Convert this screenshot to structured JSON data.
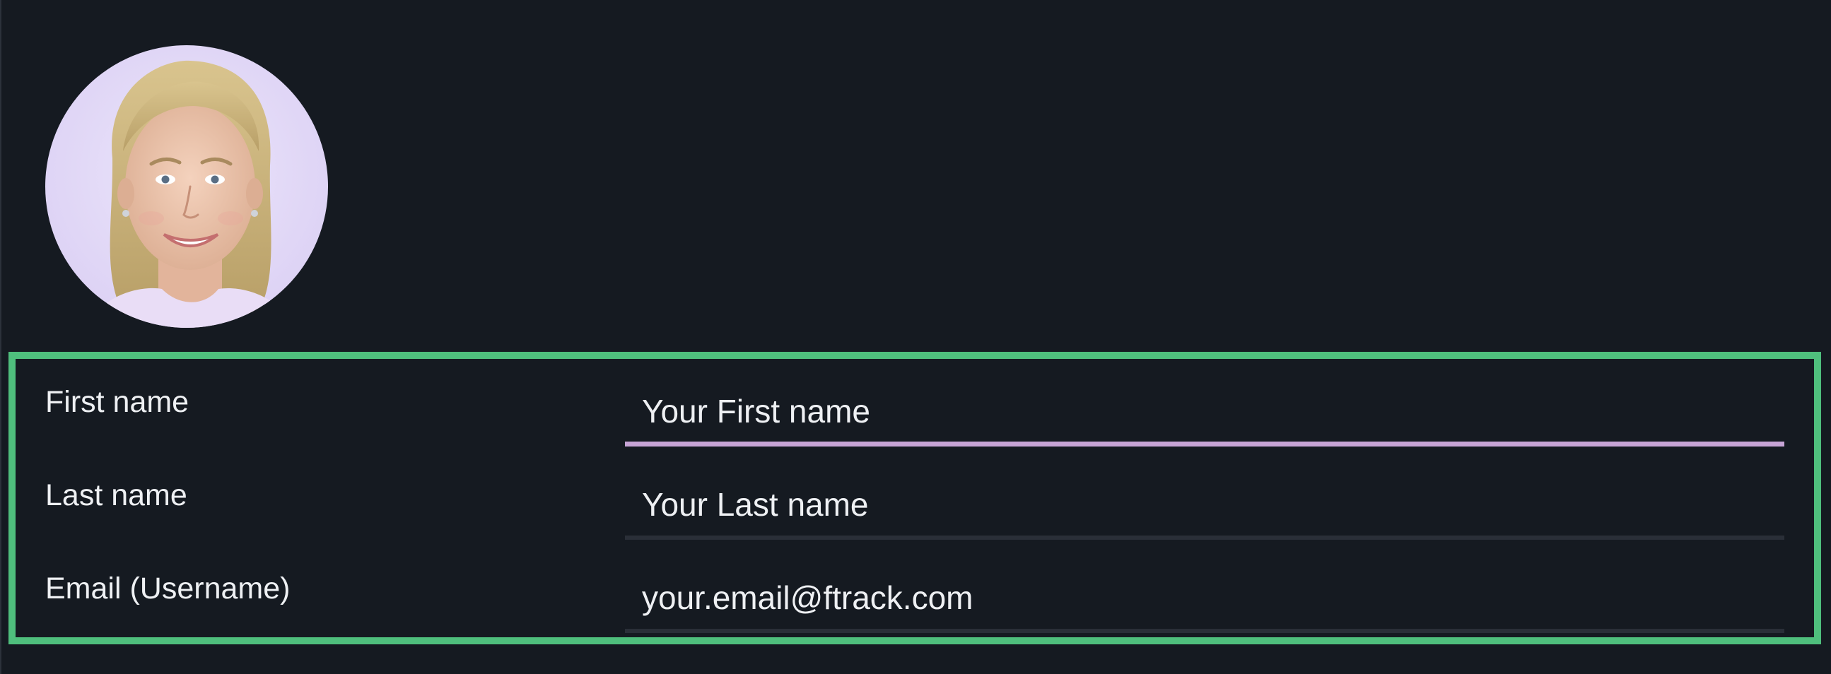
{
  "profile": {
    "avatar_icon": "user-photo",
    "form": {
      "first_name": {
        "label": "First name",
        "placeholder": "Your First name",
        "focused": true
      },
      "last_name": {
        "label": "Last name",
        "placeholder": "Your Last name"
      },
      "email": {
        "label": "Email (Username)",
        "placeholder": "your.email@ftrack.com"
      }
    }
  },
  "colors": {
    "background": "#151a21",
    "highlight": "#4fbf7d",
    "focus_underline": "#c7a4d6",
    "underline": "#2a2f38",
    "text": "#eef0f3"
  }
}
